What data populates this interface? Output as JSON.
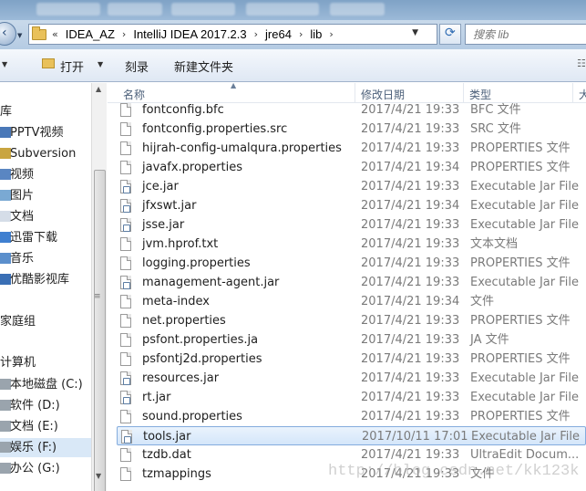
{
  "address": {
    "crumbs": [
      "IDEA_AZ",
      "IntelliJ IDEA 2017.2.3",
      "jre64",
      "lib"
    ],
    "lead": "«",
    "search_placeholder": "搜索 lib"
  },
  "toolbar": {
    "open": "打开",
    "burn": "刻录",
    "new_folder": "新建文件夹"
  },
  "sidebar": {
    "items": [
      {
        "label": "库",
        "icon": "library-icon"
      },
      {
        "label": "PPTV视频",
        "icon": "video-icon"
      },
      {
        "label": "Subversion",
        "icon": "svn-icon"
      },
      {
        "label": "视频",
        "icon": "video-icon"
      },
      {
        "label": "图片",
        "icon": "picture-icon"
      },
      {
        "label": "文档",
        "icon": "document-icon"
      },
      {
        "label": "迅雷下载",
        "icon": "download-icon"
      },
      {
        "label": "音乐",
        "icon": "music-icon"
      },
      {
        "label": "优酷影视库",
        "icon": "video-icon"
      },
      {
        "label": "家庭组",
        "icon": "homegroup-icon"
      },
      {
        "label": "计算机",
        "icon": "computer-icon"
      },
      {
        "label": "本地磁盘 (C:)",
        "icon": "drive-icon"
      },
      {
        "label": "软件 (D:)",
        "icon": "drive-icon"
      },
      {
        "label": "文档 (E:)",
        "icon": "drive-icon"
      },
      {
        "label": "娱乐 (F:)",
        "icon": "drive-icon"
      },
      {
        "label": "办公 (G:)",
        "icon": "drive-icon"
      }
    ]
  },
  "columns": {
    "name": "名称",
    "date": "修改日期",
    "type": "类型",
    "size": "大"
  },
  "files": [
    {
      "name": "fontconfig.bfc",
      "date": "2017/4/21 19:33",
      "type": "BFC 文件",
      "jar": false
    },
    {
      "name": "fontconfig.properties.src",
      "date": "2017/4/21 19:33",
      "type": "SRC 文件",
      "jar": false
    },
    {
      "name": "hijrah-config-umalqura.properties",
      "date": "2017/4/21 19:33",
      "type": "PROPERTIES 文件",
      "jar": false
    },
    {
      "name": "javafx.properties",
      "date": "2017/4/21 19:34",
      "type": "PROPERTIES 文件",
      "jar": false
    },
    {
      "name": "jce.jar",
      "date": "2017/4/21 19:33",
      "type": "Executable Jar File",
      "jar": true
    },
    {
      "name": "jfxswt.jar",
      "date": "2017/4/21 19:34",
      "type": "Executable Jar File",
      "jar": true
    },
    {
      "name": "jsse.jar",
      "date": "2017/4/21 19:33",
      "type": "Executable Jar File",
      "jar": true
    },
    {
      "name": "jvm.hprof.txt",
      "date": "2017/4/21 19:33",
      "type": "文本文档",
      "jar": false
    },
    {
      "name": "logging.properties",
      "date": "2017/4/21 19:33",
      "type": "PROPERTIES 文件",
      "jar": false
    },
    {
      "name": "management-agent.jar",
      "date": "2017/4/21 19:33",
      "type": "Executable Jar File",
      "jar": true
    },
    {
      "name": "meta-index",
      "date": "2017/4/21 19:34",
      "type": "文件",
      "jar": false
    },
    {
      "name": "net.properties",
      "date": "2017/4/21 19:33",
      "type": "PROPERTIES 文件",
      "jar": false
    },
    {
      "name": "psfont.properties.ja",
      "date": "2017/4/21 19:33",
      "type": "JA 文件",
      "jar": false
    },
    {
      "name": "psfontj2d.properties",
      "date": "2017/4/21 19:33",
      "type": "PROPERTIES 文件",
      "jar": false
    },
    {
      "name": "resources.jar",
      "date": "2017/4/21 19:33",
      "type": "Executable Jar File",
      "jar": true
    },
    {
      "name": "rt.jar",
      "date": "2017/4/21 19:33",
      "type": "Executable Jar File",
      "jar": true
    },
    {
      "name": "sound.properties",
      "date": "2017/4/21 19:33",
      "type": "PROPERTIES 文件",
      "jar": false
    },
    {
      "name": "tools.jar",
      "date": "2017/10/11 17:01",
      "type": "Executable Jar File",
      "jar": true,
      "selected": true
    },
    {
      "name": "tzdb.dat",
      "date": "2017/4/21 19:33",
      "type": "UltraEdit Docum...",
      "jar": false
    },
    {
      "name": "tzmappings",
      "date": "2017/4/21 19:33",
      "type": "文件",
      "jar": false
    }
  ],
  "watermark": "http://blog.csdn.net/kk123k",
  "colors": {
    "selection_bg": "#d4e6fa",
    "selection_border": "#84acdd",
    "toolbar_bg": "#dfe8f4"
  }
}
